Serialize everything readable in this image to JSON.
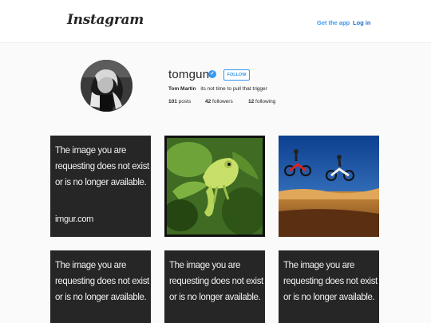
{
  "header": {
    "logo": "Instagram",
    "get_app": "Get the app",
    "login": "Log in"
  },
  "profile": {
    "username": "tomgun",
    "verified": true,
    "follow_label": "FOLLOW",
    "full_name": "Tom Martin",
    "bio": "its not time to pull that trigger",
    "posts_count": "101",
    "posts_label": "posts",
    "followers_count": "42",
    "followers_label": "followers",
    "following_count": "12",
    "following_label": "following"
  },
  "posts": {
    "missing_line1": "The image you are",
    "missing_line2": "requesting does not exist",
    "missing_line3": "or is no longer available.",
    "missing_source": "imgur.com"
  },
  "colors": {
    "accent": "#3897f0",
    "missing_tile_bg": "#262626"
  },
  "icons": {
    "verified": "verified-check-icon"
  }
}
